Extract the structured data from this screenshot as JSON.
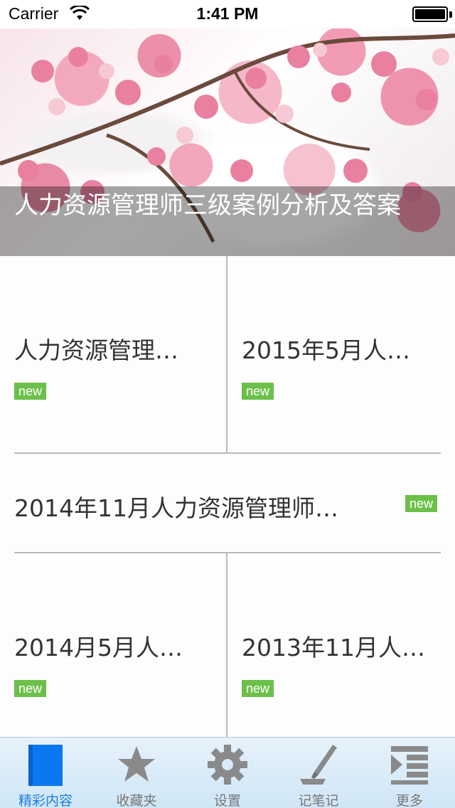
{
  "status_bar": {
    "carrier": "Carrier",
    "time": "1:41 PM"
  },
  "banner": {
    "title": "人力资源管理师三级案例分析及答案"
  },
  "items": [
    {
      "title": "人力资源管理…",
      "badge": "new"
    },
    {
      "title": "2015年5月人…",
      "badge": "new"
    },
    {
      "title": "2014年11月人力资源管理师…",
      "badge": "new"
    },
    {
      "title": "2014月5月人…",
      "badge": "new"
    },
    {
      "title": "2013年11月人…",
      "badge": "new"
    }
  ],
  "tabs": [
    {
      "label": "精彩内容",
      "icon": "document-icon",
      "active": true
    },
    {
      "label": "收藏夹",
      "icon": "star-icon",
      "active": false
    },
    {
      "label": "设置",
      "icon": "gear-icon",
      "active": false
    },
    {
      "label": "记笔记",
      "icon": "pen-icon",
      "active": false
    },
    {
      "label": "更多",
      "icon": "list-icon",
      "active": false
    }
  ],
  "colors": {
    "accent": "#1b7fe0",
    "badge": "#6cc04a",
    "tab_inactive": "#777777"
  }
}
